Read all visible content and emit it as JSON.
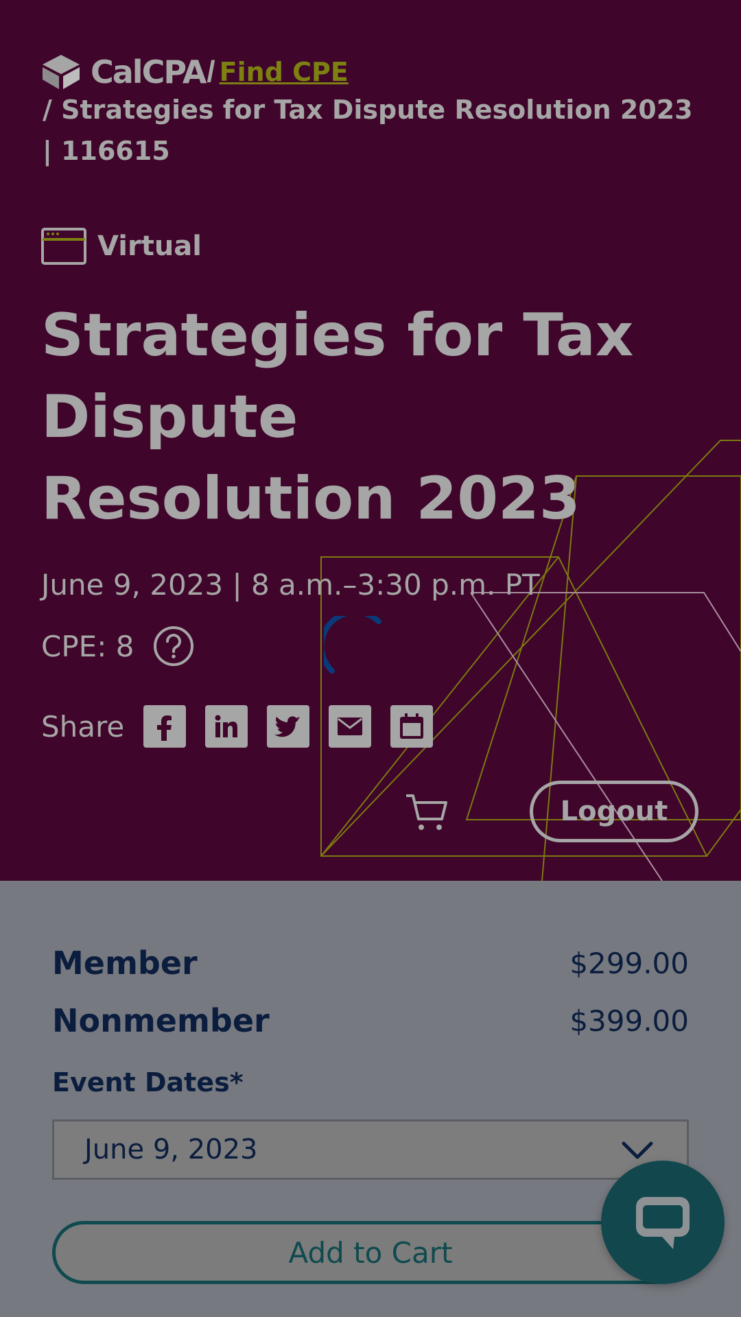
{
  "breadcrumb": {
    "brand": "CalCPA",
    "separator": "/",
    "link_label": "Find CPE",
    "current": "/ Strategies for Tax Dispute Resolution 2023 | 116615"
  },
  "event": {
    "format": "Virtual",
    "title": "Strategies for Tax Dispute Resolution 2023",
    "date_time": "June 9, 2023 | 8 a.m.–3:30 p.m. PT",
    "cpe": "CPE: 8"
  },
  "share": {
    "label": "Share",
    "icons": [
      "facebook-icon",
      "linkedin-icon",
      "twitter-icon",
      "email-icon",
      "calendar-icon"
    ]
  },
  "header_actions": {
    "cart_icon": "cart-icon",
    "logout_label": "Logout"
  },
  "pricing": {
    "member_label": "Member",
    "member_price": "$299.00",
    "nonmember_label": "Nonmember",
    "nonmember_price": "$399.00"
  },
  "event_dates": {
    "label": "Event Dates*",
    "selected": "June 9, 2023"
  },
  "add_to_cart_label": "Add to Cart",
  "chat_icon": "chat-icon",
  "colors": {
    "hero_bg": "#3f052a",
    "link": "#7c8112",
    "navy": "#0b1d3e",
    "teal": "#11474d",
    "spinner": "#0a3a7a"
  }
}
